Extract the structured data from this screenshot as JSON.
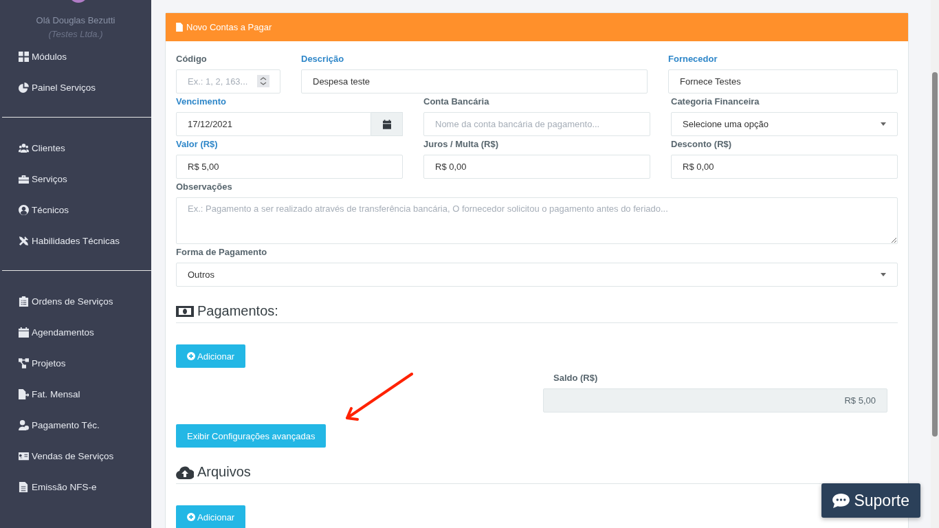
{
  "sidebar": {
    "greeting": "Olá Douglas Bezutti",
    "company": "(Testes Ltda.)",
    "groups": [
      {
        "items": [
          {
            "label": "Módulos"
          },
          {
            "label": "Painel Serviços"
          }
        ]
      },
      {
        "items": [
          {
            "label": "Clientes"
          },
          {
            "label": "Serviços"
          },
          {
            "label": "Técnicos"
          },
          {
            "label": "Habilidades Técnicas"
          }
        ]
      },
      {
        "items": [
          {
            "label": "Ordens de Serviços"
          },
          {
            "label": "Agendamentos"
          },
          {
            "label": "Projetos"
          },
          {
            "label": "Fat. Mensal"
          },
          {
            "label": "Pagamento Téc."
          },
          {
            "label": "Vendas de Serviços"
          },
          {
            "label": "Emissão NFS-e"
          }
        ]
      }
    ]
  },
  "card": {
    "title": "Novo Contas a Pagar",
    "rows": [
      {
        "fields": [
          {
            "label": "Código",
            "required": false,
            "kind": "number",
            "placeholder": "Ex.: 1, 2, 163..."
          },
          {
            "label": "Descrição",
            "required": true,
            "kind": "text",
            "value": "Despesa teste"
          },
          {
            "label": "Fornecedor",
            "required": true,
            "kind": "text",
            "value": "Fornece Testes"
          }
        ]
      },
      {
        "fields": [
          {
            "label": "Vencimento",
            "required": true,
            "kind": "date",
            "value": "17/12/2021"
          },
          {
            "label": "Conta Bancária",
            "required": false,
            "kind": "text",
            "placeholder": "Nome da conta bancária de pagamento..."
          },
          {
            "label": "Categoria Financeira",
            "required": false,
            "kind": "select",
            "value": "Selecione uma opção"
          }
        ]
      },
      {
        "fields": [
          {
            "label": "Valor (R$)",
            "required": true,
            "kind": "text",
            "value": "R$ 5,00"
          },
          {
            "label": "Juros / Multa (R$)",
            "required": false,
            "kind": "text",
            "value": "R$ 0,00"
          },
          {
            "label": "Desconto (R$)",
            "required": false,
            "kind": "text",
            "value": "R$ 0,00"
          }
        ]
      },
      {
        "fields": [
          {
            "label": "Observações",
            "required": false,
            "kind": "textarea",
            "placeholder": "Ex.: Pagamento a ser realizado através de transferência bancária, O fornecedor solicitou o pagamento antes do feriado..."
          }
        ]
      },
      {
        "fields": [
          {
            "label": "Forma de Pagamento",
            "required": false,
            "kind": "select",
            "value": "Outros"
          }
        ]
      }
    ],
    "payments": {
      "title": "Pagamentos:",
      "add_button": "Adicionar",
      "balance_label": "Saldo (R$)",
      "balance": "R$ 5,00",
      "advanced_button": "Exibir Configurações avançadas"
    },
    "files": {
      "title": "Arquivos",
      "add_button": "Adicionar"
    }
  },
  "support_button": "Suporte"
}
